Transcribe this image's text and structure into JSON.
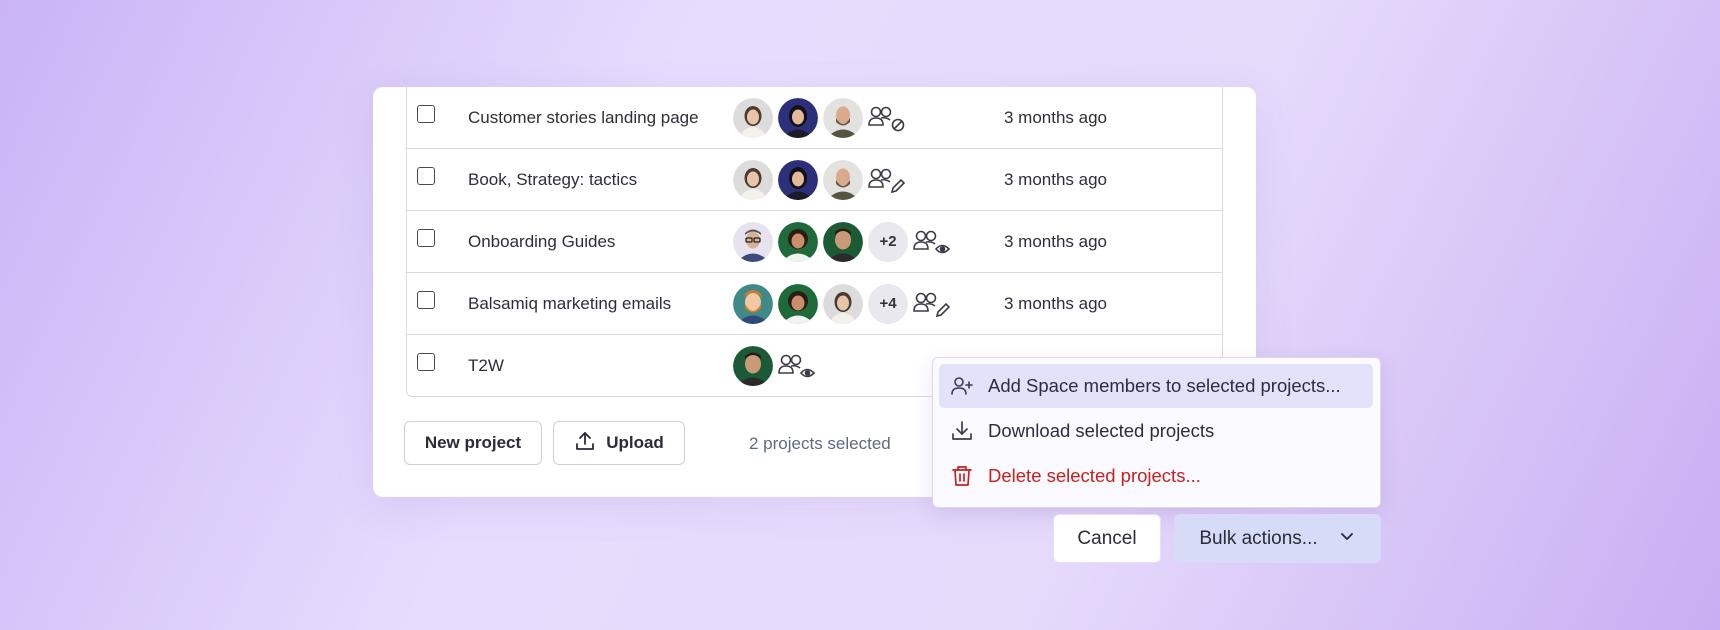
{
  "projects": [
    {
      "name": "Customer stories landing page",
      "avatars": [
        "woman-long-hair",
        "woman-dark-hair-blue",
        "man-bald-beard"
      ],
      "extra": "",
      "permission": "no-access-icon",
      "updated": "3 months ago"
    },
    {
      "name": "Book, Strategy: tactics",
      "avatars": [
        "woman-long-hair",
        "woman-dark-hair-blue",
        "man-bald-beard"
      ],
      "extra": "",
      "permission": "edit-icon",
      "updated": "3 months ago"
    },
    {
      "name": "Onboarding Guides",
      "avatars": [
        "man-glasses",
        "woman-curly-green",
        "man-smiling-green"
      ],
      "extra": "+2",
      "permission": "view-icon",
      "updated": "3 months ago"
    },
    {
      "name": "Balsamiq marketing emails",
      "avatars": [
        "man-red-beard-cartoon",
        "woman-curly-green",
        "woman-long-hair"
      ],
      "extra": "+4",
      "permission": "edit-icon",
      "updated": "3 months ago"
    },
    {
      "name": "T2W",
      "avatars": [
        "man-smiling-green"
      ],
      "extra": "",
      "permission": "view-icon",
      "updated": ""
    }
  ],
  "footer": {
    "new_project_label": "New project",
    "upload_label": "Upload",
    "selected_count": "2 projects selected"
  },
  "bulk_menu": {
    "items": [
      {
        "label": "Add Space members to selected projects...",
        "icon": "add-user-icon"
      },
      {
        "label": "Download selected projects",
        "icon": "download-icon"
      },
      {
        "label": "Delete selected projects...",
        "icon": "trash-icon"
      }
    ]
  },
  "actions": {
    "cancel_label": "Cancel",
    "bulk_label": "Bulk actions..."
  },
  "colors": {
    "accent_bg": "#d6dcf8",
    "menu_active": "#e2e2fb",
    "danger": "#c8201e",
    "muted_text": "#5d6b80"
  }
}
